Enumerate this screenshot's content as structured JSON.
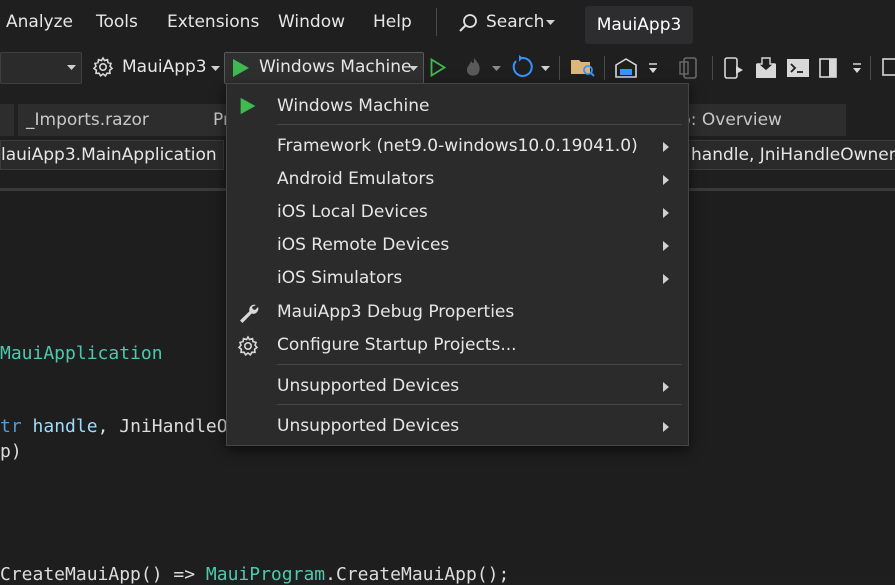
{
  "menubar": {
    "items": [
      "Analyze",
      "Tools",
      "Extensions",
      "Window",
      "Help"
    ],
    "search_label": "Search",
    "project": "MauiApp3"
  },
  "toolbar": {
    "startup_project": "MauiApp3",
    "run_target": "Windows Machine"
  },
  "tabs": [
    {
      "label": "_Imports.razor"
    },
    {
      "label": "Pr"
    },
    {
      "label": "b: Overview"
    }
  ],
  "navbar": {
    "left": "lauiApp3.MainApplication",
    "right": "handle, JniHandleOwnersh"
  },
  "code": {
    "line1": "MauiApplication",
    "line2_kw": "tr",
    "line2_id": "handle",
    "line2_rest": ", JniHandleO",
    "line3": "p)",
    "line4_a": "CreateMauiApp() => ",
    "line4_b": "MauiProgram",
    "line4_c": ".CreateMauiApp();"
  },
  "dropdown": {
    "items": [
      {
        "label": "Windows Machine",
        "icon": "play-icon",
        "submenu": false
      },
      {
        "label": "Framework (net9.0-windows10.0.19041.0)",
        "icon": "",
        "submenu": true
      },
      {
        "label": "Android Emulators",
        "icon": "",
        "submenu": true
      },
      {
        "label": "iOS Local Devices",
        "icon": "",
        "submenu": true
      },
      {
        "label": "iOS Remote Devices",
        "icon": "",
        "submenu": true
      },
      {
        "label": "iOS Simulators",
        "icon": "",
        "submenu": true
      },
      {
        "label": "MauiApp3 Debug Properties",
        "icon": "wrench-icon",
        "submenu": false
      },
      {
        "label": "Configure Startup Projects...",
        "icon": "gear-icon",
        "submenu": false
      },
      {
        "label": "Unsupported Devices",
        "icon": "",
        "submenu": true
      },
      {
        "label": "Unsupported Devices",
        "icon": "",
        "submenu": true
      }
    ]
  },
  "colors": {
    "play_green": "#3fb950",
    "accent_blue": "#3794ff"
  }
}
